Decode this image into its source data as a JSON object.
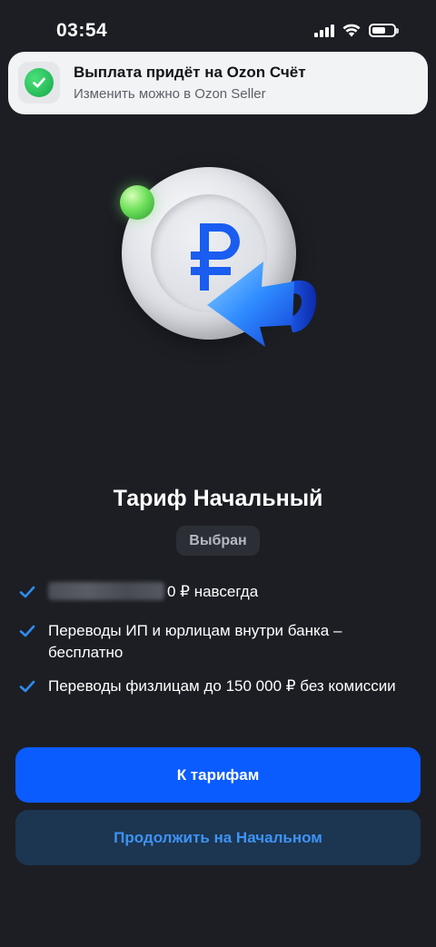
{
  "status_bar": {
    "time": "03:54",
    "icons": [
      "signal-icon",
      "wifi-icon",
      "battery-icon"
    ]
  },
  "notification": {
    "title": "Выплата придёт на Ozon Счёт",
    "subtitle": "Изменить можно в Ozon Seller",
    "icon": "check-circle-icon"
  },
  "illustration": {
    "icon": "ruble-coin-icon",
    "symbol": "₽"
  },
  "plan": {
    "title": "Тариф Начальный",
    "badge": "Выбран"
  },
  "features": [
    {
      "icon": "check-icon",
      "text": "0 ₽ навсегда",
      "has_blurred_prefix": true
    },
    {
      "icon": "check-icon",
      "text": "Переводы ИП и юрлицам внутри банка – бесплатно"
    },
    {
      "icon": "check-icon",
      "text": "Переводы физлицам до 150 000 ₽ без комиссии"
    }
  ],
  "buttons": {
    "primary": "К тарифам",
    "secondary": "Продолжить на Начальном"
  },
  "colors": {
    "background": "#1c1e24",
    "accent": "#0b5cff",
    "secondary_button_bg": "#1c3550",
    "secondary_button_text": "#3d93f5",
    "check": "#2f8cf0"
  }
}
